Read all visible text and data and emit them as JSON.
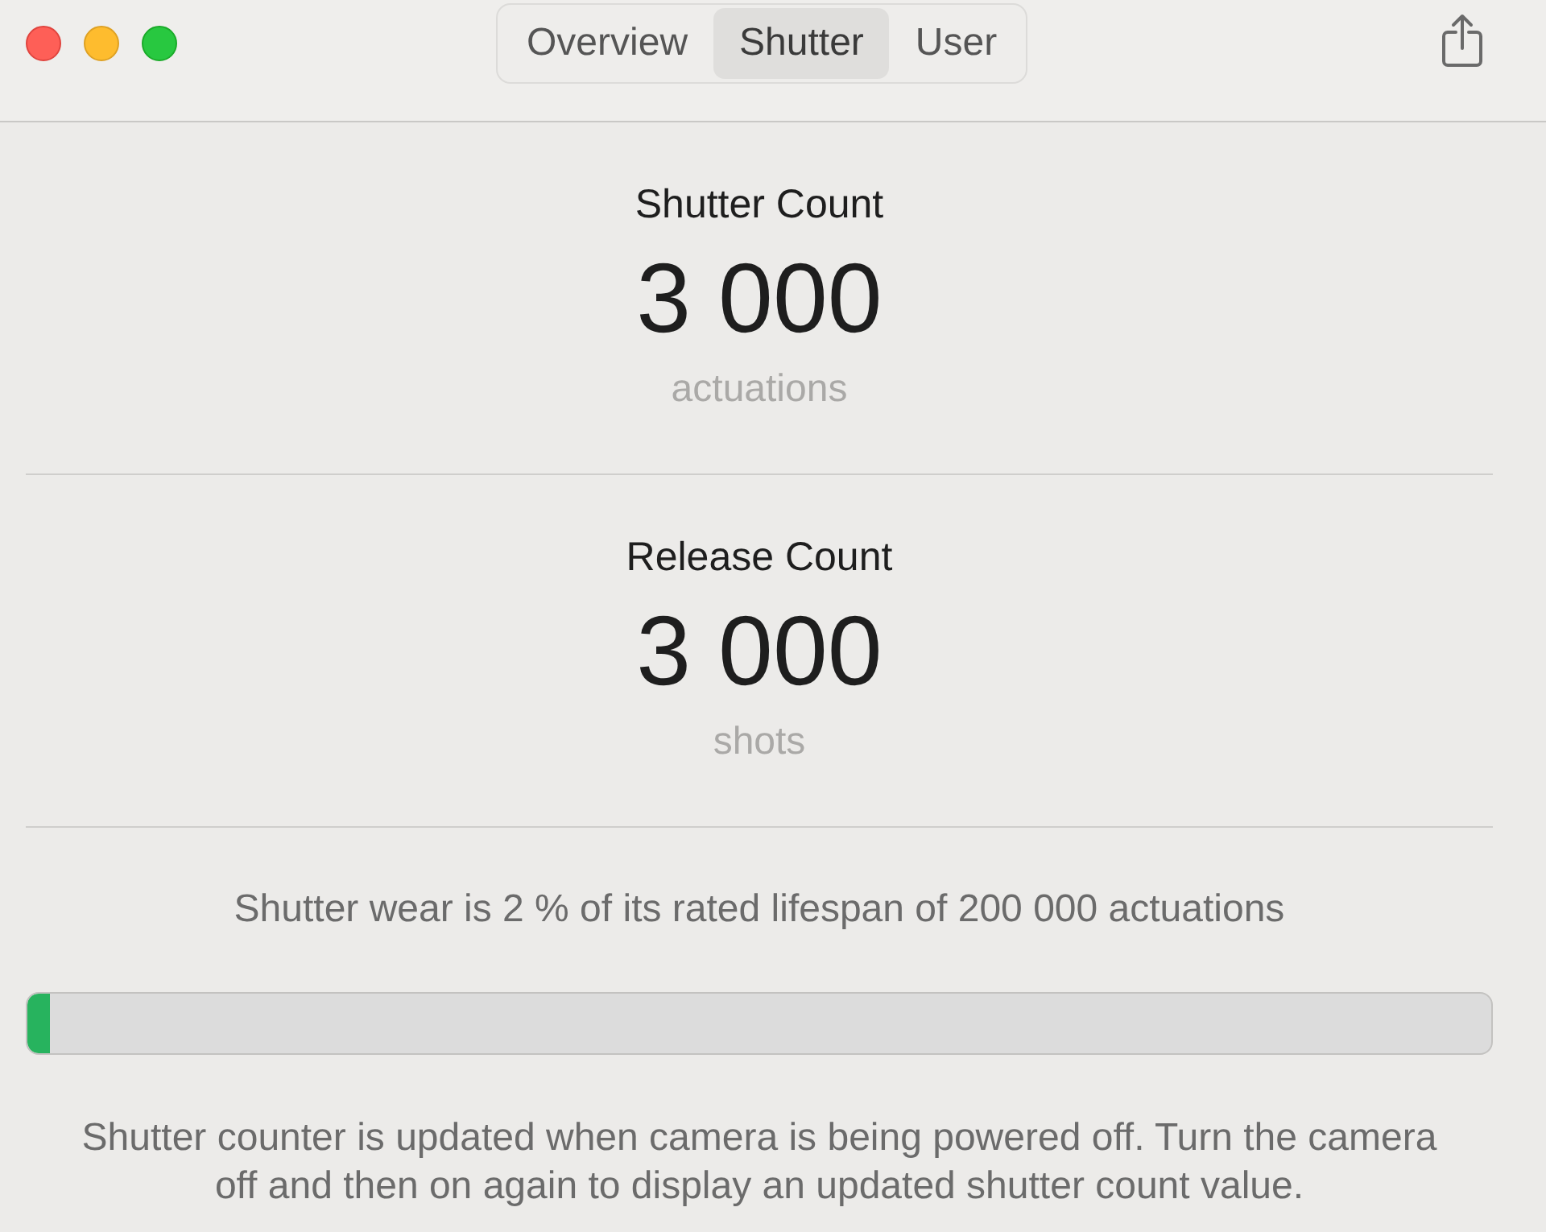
{
  "window": {
    "controls": [
      {
        "kind": "close"
      },
      {
        "kind": "minimize"
      },
      {
        "kind": "zoom"
      }
    ]
  },
  "tabs": [
    {
      "label": "Overview",
      "selected": false
    },
    {
      "label": "Shutter",
      "selected": true
    },
    {
      "label": "User",
      "selected": false
    }
  ],
  "counters": [
    {
      "title": "Shutter Count",
      "value": "3 000",
      "unit": "actuations"
    },
    {
      "title": "Release Count",
      "value": "3 000",
      "unit": "shots"
    }
  ],
  "wear": {
    "text": "Shutter wear is 2 % of its rated lifespan of 200 000 actuations",
    "level": 0.015
  },
  "note": "Shutter counter is updated when camera is being powered off. Turn the camera off and then on again to display an updated shutter count value."
}
